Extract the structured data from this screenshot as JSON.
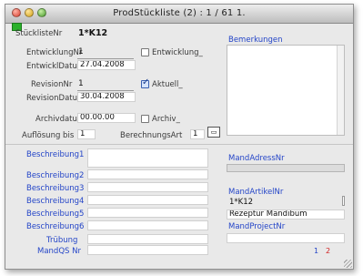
{
  "window": {
    "title": "ProdStückliste (2) : 1 / 61 1."
  },
  "colors": {
    "accent_blue": "#2445c8",
    "page_red": "#d21f1f"
  },
  "header": {
    "stuecklistenr_label": "StücklisteNr",
    "stuecklistenr_value": "1*K12"
  },
  "entwicklung": {
    "nr_label": "EntwicklungNr",
    "nr_value": "1",
    "checkbox_label": "Entwicklung_",
    "checked": false,
    "datum_label": "EntwicklDatum",
    "datum_value": "27.04.2008"
  },
  "revision": {
    "nr_label": "RevisionNr",
    "nr_value": "1",
    "checkbox_label": "Aktuell_",
    "checked": true,
    "datum_label": "RevisionDatum",
    "datum_value": "30.04.2008"
  },
  "archiv": {
    "datum_label": "Archivdatum",
    "datum_value": "00.00.00",
    "checkbox_label": "Archiv_",
    "checked": false
  },
  "aufloesung": {
    "label": "Auflösung bis",
    "value": "1"
  },
  "berechnung": {
    "label": "BerechnungsArt",
    "value": "1"
  },
  "bemerkungen": {
    "label": "Bemerkungen"
  },
  "beschreibungen": [
    {
      "label": "Beschreibung1",
      "value": ""
    },
    {
      "label": "Beschreibung2",
      "value": ""
    },
    {
      "label": "Beschreibung3",
      "value": ""
    },
    {
      "label": "Beschreibung4",
      "value": ""
    },
    {
      "label": "Beschreibung5",
      "value": ""
    },
    {
      "label": "Beschreibung6",
      "value": ""
    }
  ],
  "truebung": {
    "label": "Trübung",
    "value": ""
  },
  "mandqs": {
    "label": "MandQS Nr",
    "value": ""
  },
  "mand": {
    "adress_label": "MandAdressNr",
    "adress_value": "",
    "artikel_label": "MandArtikelNr",
    "artikel_value": "1*K12",
    "bezeichnung_value": "Rezeptur Mandibum",
    "project_label": "MandProjectNr",
    "project_value": ""
  },
  "pages": {
    "page1": "1",
    "page2": "2"
  }
}
